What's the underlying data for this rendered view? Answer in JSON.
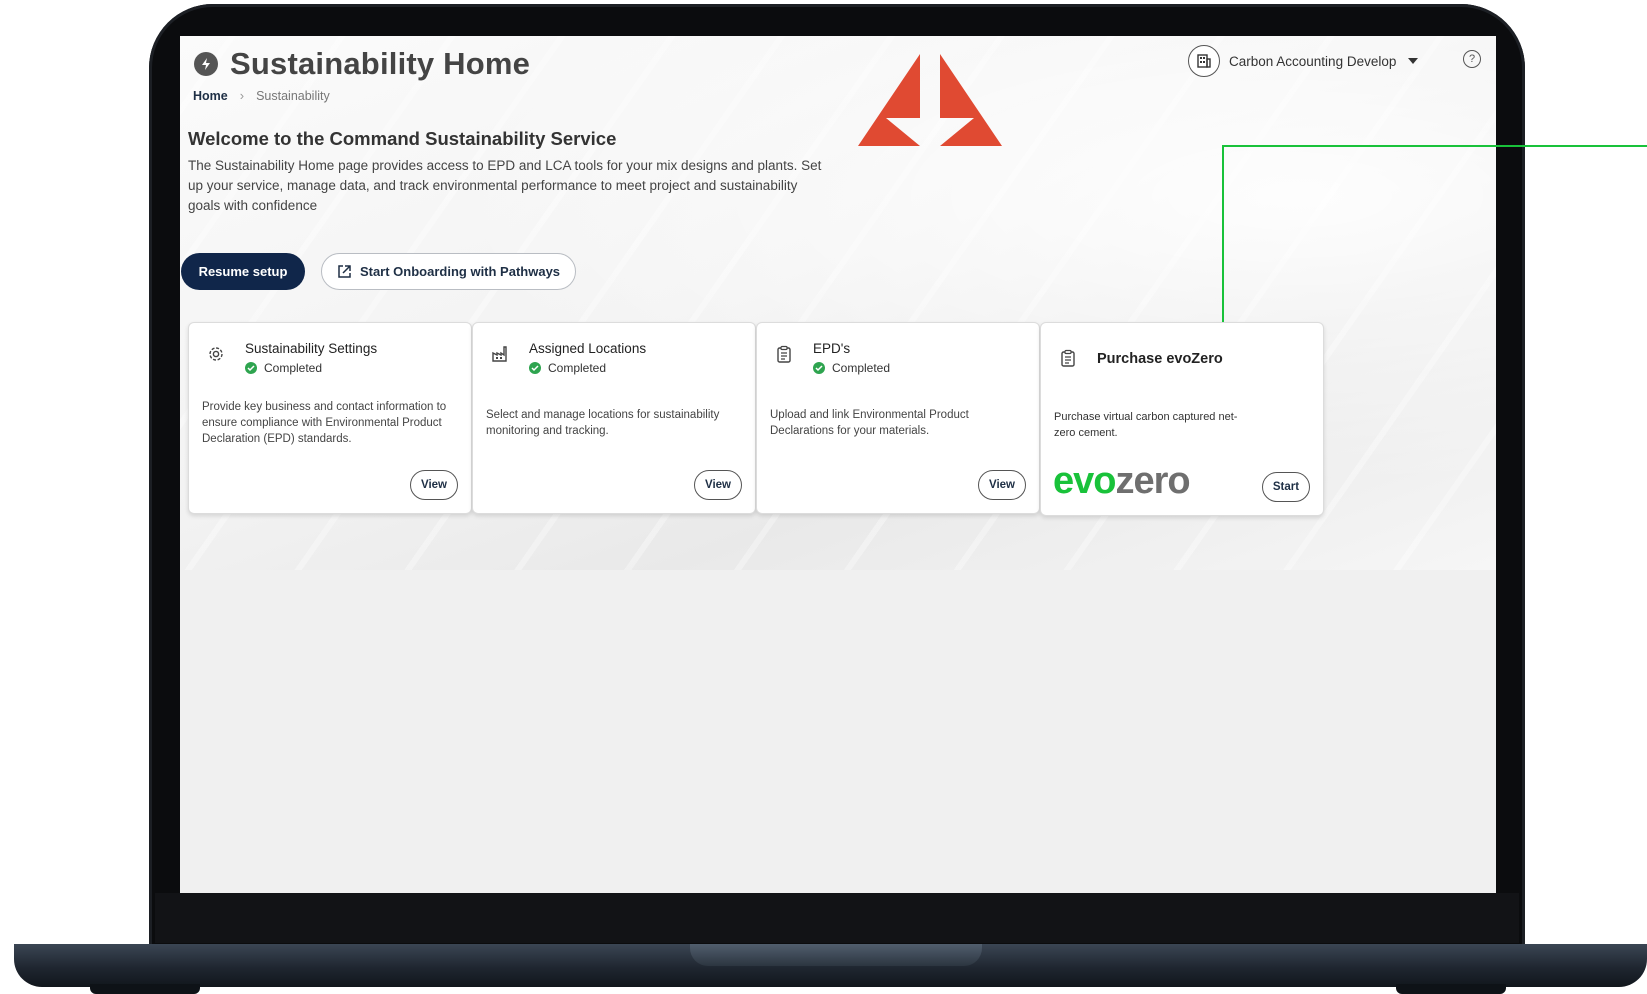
{
  "app": {
    "title": "Sustainability Home",
    "breadcrumb": {
      "home": "Home",
      "current": "Sustainability"
    },
    "org_switcher": {
      "label": "Carbon Accounting Develop"
    },
    "help_label": "?"
  },
  "welcome": {
    "title": "Welcome to the Command Sustainability Service",
    "description": "The Sustainability Home page provides access to EPD and LCA tools for your mix designs and plants. Set up your service, manage data, and track environmental performance to meet project and sustainability goals with confidence"
  },
  "actions": {
    "resume_label": "Resume setup",
    "pathways_label": "Start Onboarding with Pathways"
  },
  "cards": [
    {
      "title": "Sustainability Settings",
      "status": "Completed",
      "description": "Provide key business and contact information to ensure compliance with Environmental Product Declaration (EPD) standards.",
      "button": "View",
      "icon": "gear-icon"
    },
    {
      "title": "Assigned Locations",
      "status": "Completed",
      "description": "Select and manage locations for sustainability monitoring and tracking.",
      "button": "View",
      "icon": "factory-icon"
    },
    {
      "title": "EPD's",
      "status": "Completed",
      "description": "Upload and link Environmental Product Declarations for your materials.",
      "button": "View",
      "icon": "clipboard-icon"
    },
    {
      "title": "Purchase evoZero",
      "description": "Purchase virtual carbon captured net-zero cement.",
      "button": "Start",
      "logo_part1": "evo",
      "logo_part2": "zero",
      "icon": "clipboard-icon"
    }
  ],
  "colors": {
    "primary": "#10264a",
    "success": "#2ea44f",
    "brand_red": "#e04a32",
    "evo_green": "#19c23a",
    "annotation": "#19c23a"
  }
}
